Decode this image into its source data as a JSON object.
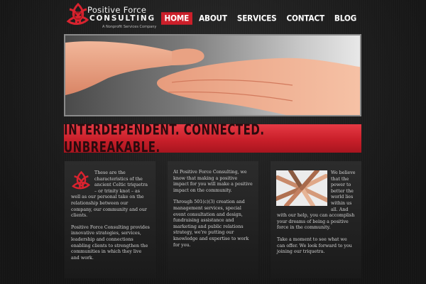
{
  "brand": {
    "line1": "Positive Force",
    "line2": "CONSULTING",
    "tagline": "A Nonprofit Services Company",
    "accent": "#cc1f2a"
  },
  "nav": [
    {
      "label": "HOME",
      "active": true
    },
    {
      "label": "ABOUT",
      "active": false
    },
    {
      "label": "SERVICES",
      "active": false
    },
    {
      "label": "CONTACT",
      "active": false
    },
    {
      "label": "BLOG",
      "active": false
    }
  ],
  "hero": {
    "image": "two-hands-reaching-photo"
  },
  "banner": {
    "text": "INTERDEPENDENT. CONNECTED. UNBREAKABLE."
  },
  "columns": [
    {
      "icon": "triquetra-icon",
      "paragraphs": [
        "These are the characteristics of the ancient Celtic triquetra – or trinity knot – as well as our personal take on the relationship between our company, our community and our clients.",
        "Positive Force Consulting provides innovative strategies, services, leadership and connections enabling clients to strengthen the communities in which they live and work."
      ]
    },
    {
      "paragraphs": [
        "At Positive Force Consulting, we know that making a positive impact for you will make a positive impact on the community.",
        "Through 501(c)(3) creation and management services, special event consultation and design, fundraising assistance and marketing and public relations strategy, we're putting our knowledge and expertise to work for you."
      ]
    },
    {
      "image": "stacked-hands-photo",
      "paragraphs": [
        "We believe that the power to better the world lies within us all. And with our help, you can accomplish your dreams of being a positive force in the community.",
        "Take a moment to see what we can offer. We look forward to you joining our triquetra."
      ]
    }
  ]
}
